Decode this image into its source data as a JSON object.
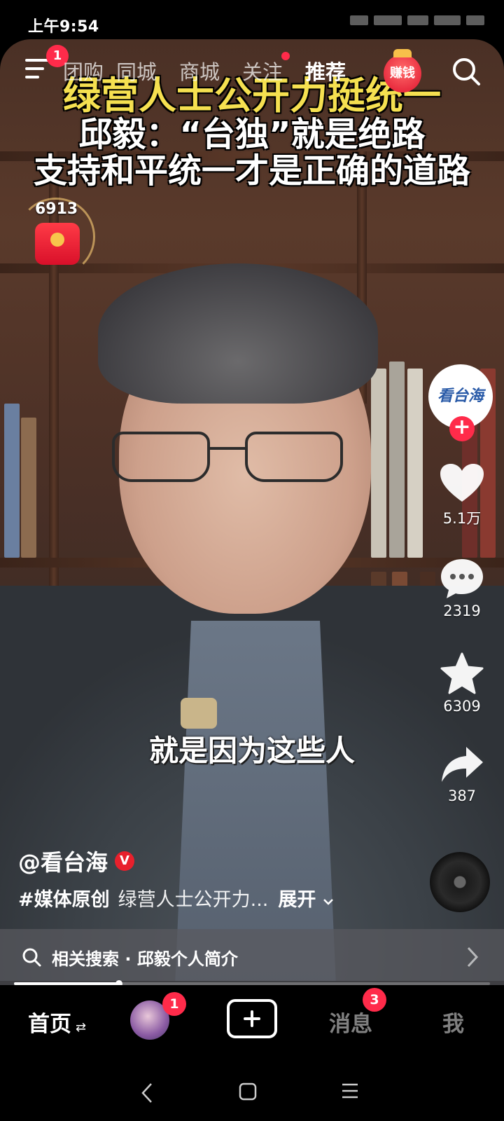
{
  "status_bar": {
    "time": "上午9:54"
  },
  "top_nav": {
    "menu_badge": "1",
    "tabs": [
      {
        "label": "团购",
        "active": false
      },
      {
        "label": "同城",
        "active": false
      },
      {
        "label": "商城",
        "active": false
      },
      {
        "label": "关注",
        "active": false,
        "dot": true
      },
      {
        "label": "推荐",
        "active": true
      }
    ],
    "earn_label": "赚钱"
  },
  "video": {
    "headline": [
      "绿营人士公开力挺统一",
      "邱毅：“台独”就是绝路",
      "支持和平统一才是正确的道路"
    ],
    "subtitle": "就是因为这些人",
    "watermark": "看台海"
  },
  "red_packet": {
    "count": "6913"
  },
  "right_rail": {
    "avatar_text": "看台海",
    "likes": "5.1万",
    "comments": "2319",
    "favorites": "6309",
    "shares": "387"
  },
  "caption": {
    "author": "@看台海",
    "verified_badge": "V",
    "hashtag": "#媒体原创",
    "text": "绿营人士公开力...",
    "expand_label": "展开"
  },
  "related_search": {
    "label": "相关搜索 · 邱毅个人简介"
  },
  "progress": {
    "fraction": 0.22
  },
  "tab_bar": {
    "home": "首页",
    "friend_badge": "1",
    "messages": "消息",
    "messages_badge": "3",
    "me": "我"
  },
  "colors": {
    "accent": "#ff2b4a",
    "headline_yellow": "#f5e050"
  }
}
